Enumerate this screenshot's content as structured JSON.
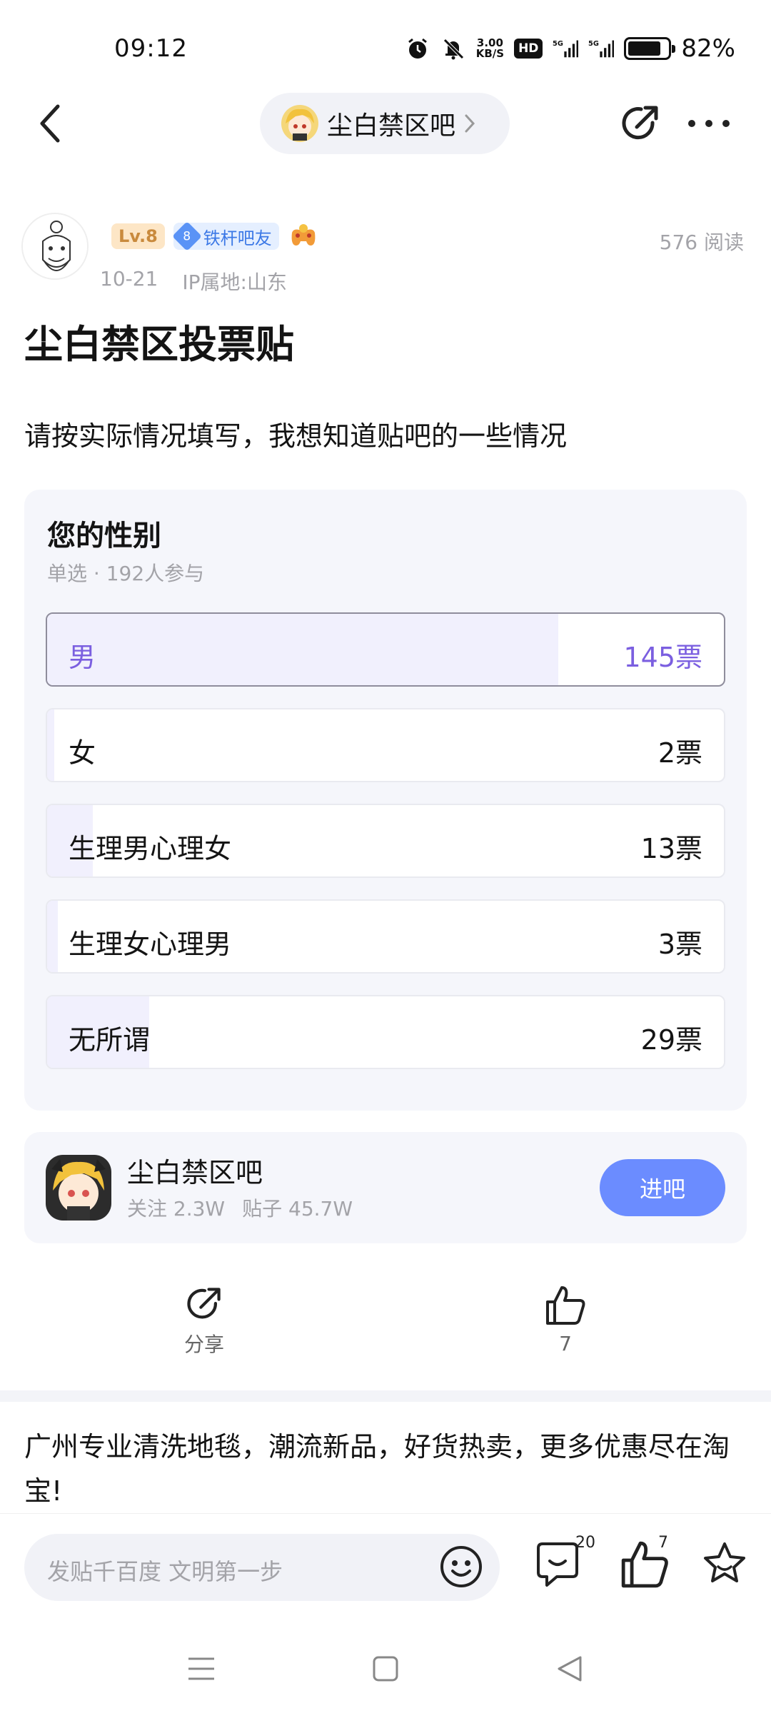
{
  "status_bar": {
    "time": "09:12",
    "net_speed_value": "3.00",
    "net_speed_unit": "KB/S",
    "hd_label": "HD",
    "battery_percent": "82%",
    "battery_level": 0.82,
    "icons": [
      "alarm-icon",
      "mute-icon",
      "hd-icon",
      "signal-5g-icon",
      "signal-5g-icon",
      "battery-icon"
    ]
  },
  "nav": {
    "forum_name": "尘白禁区吧"
  },
  "author": {
    "level": "Lv.8",
    "fan_level": "8",
    "fan_title": "铁杆吧友",
    "post_date": "10-21",
    "ip_location": "IP属地:山东",
    "read_count": "576 阅读"
  },
  "post": {
    "title": "尘白禁区投票贴",
    "body": "请按实际情况填写，我想知道贴吧的一些情况"
  },
  "poll": {
    "question": "您的性别",
    "subtitle": "单选 · 192人参与",
    "options": [
      {
        "label": "男",
        "votes": "145票",
        "count": 145,
        "selected": true
      },
      {
        "label": "女",
        "votes": "2票",
        "count": 2,
        "selected": false
      },
      {
        "label": "生理男心理女",
        "votes": "13票",
        "count": 13,
        "selected": false
      },
      {
        "label": "生理女心理男",
        "votes": "3票",
        "count": 3,
        "selected": false
      },
      {
        "label": "无所谓",
        "votes": "29票",
        "count": 29,
        "selected": false
      }
    ],
    "total_participants": 192,
    "selected_color": "#7b5fe0"
  },
  "forum_card": {
    "name": "尘白禁区吧",
    "followers": "关注 2.3W",
    "posts": "贴子 45.7W",
    "join_label": "进吧"
  },
  "actions": {
    "share_label": "分享",
    "like_count": "7"
  },
  "ad": {
    "text": "广州专业清洗地毯，潮流新品，好货热卖，更多优惠尽在淘宝!"
  },
  "input_bar": {
    "placeholder": "发贴千百度 文明第一步",
    "comment_count": "20",
    "like_count": "7"
  },
  "colors": {
    "accent": "#6b8cff",
    "poll_fill": "#f1f0fd",
    "card_bg": "#f5f6fb"
  }
}
